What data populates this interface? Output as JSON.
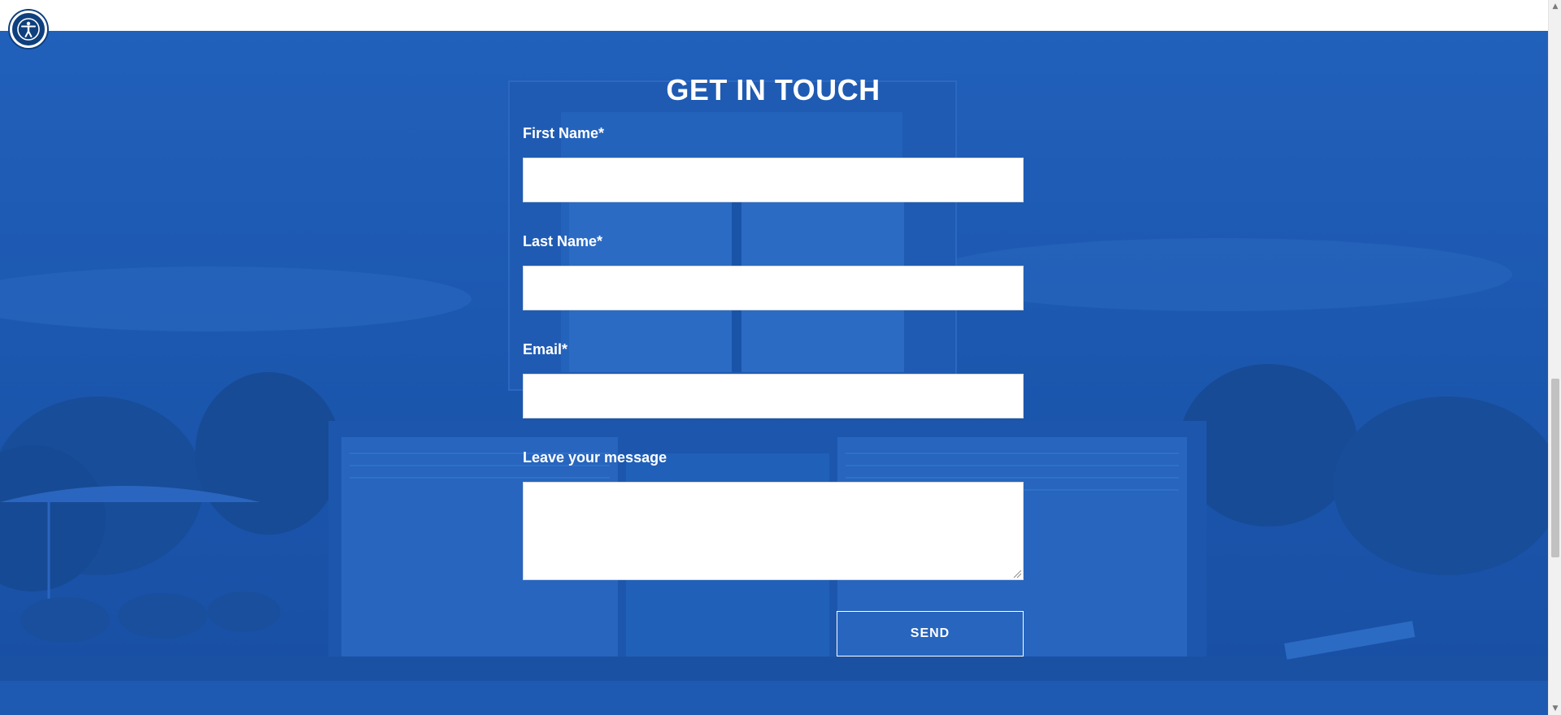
{
  "form": {
    "title": "GET IN TOUCH",
    "first_name_label": "First Name*",
    "first_name_value": "",
    "last_name_label": "Last Name*",
    "last_name_value": "",
    "email_label": "Email*",
    "email_value": "",
    "message_label": "Leave your message",
    "message_value": "",
    "send_label": "SEND"
  },
  "colors": {
    "section_background": "#1d58b1",
    "accent": "#0f3f7d",
    "text": "#ffffff"
  },
  "icons": {
    "accessibility": "accessibility-icon",
    "scroll_up": "scroll-up-arrow-icon",
    "scroll_down": "scroll-down-arrow-icon"
  }
}
